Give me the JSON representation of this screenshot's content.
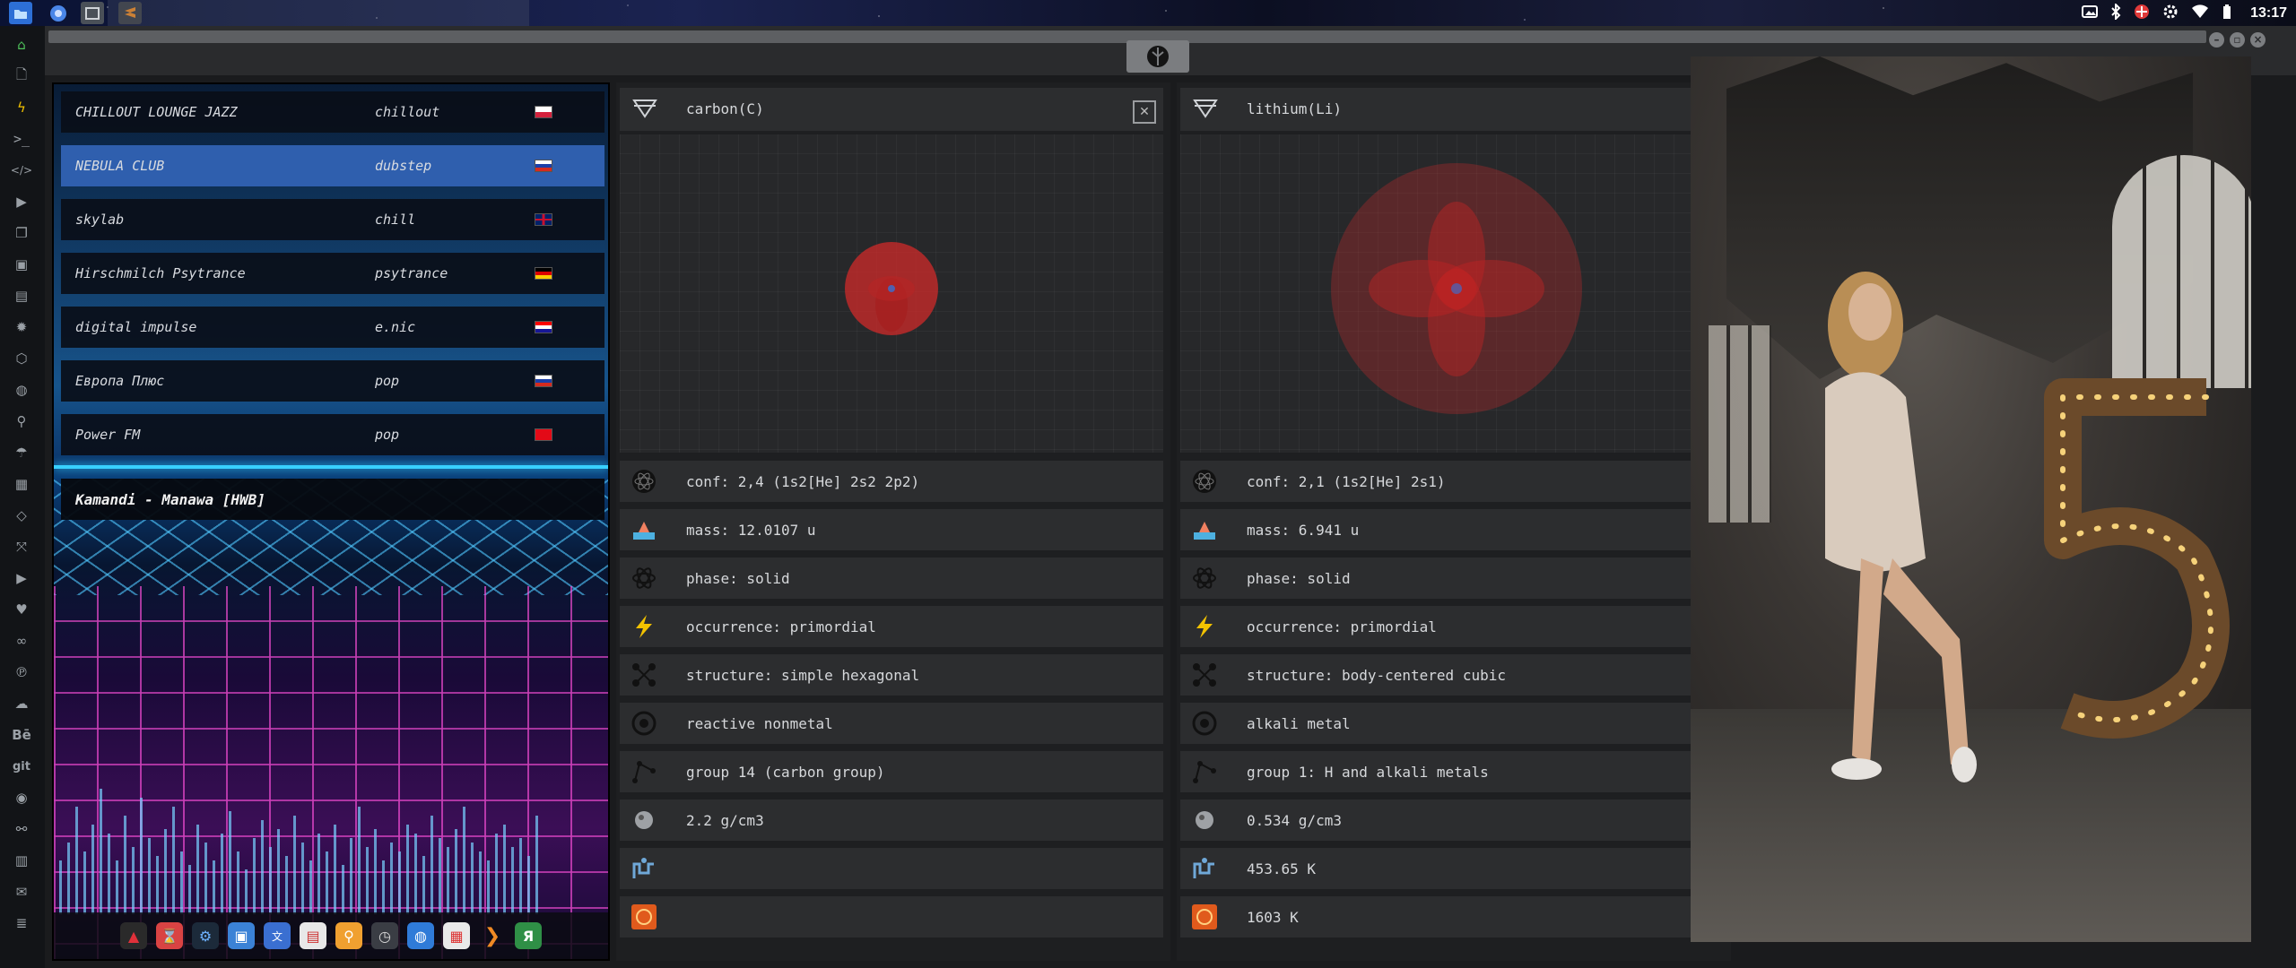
{
  "panel": {
    "clock": "13:17"
  },
  "window_title_emblem": "rebel-alliance-icon",
  "radio": {
    "stations": [
      {
        "name": "CHILLOUT LOUNGE JAZZ",
        "genre": "chillout",
        "flag": "poland"
      },
      {
        "name": "NEBULA CLUB",
        "genre": "dubstep",
        "flag": "russia",
        "selected": true
      },
      {
        "name": "skylab",
        "genre": "chill",
        "flag": "uk"
      },
      {
        "name": "Hirschmilch Psytrance",
        "genre": "psytrance",
        "flag": "germany"
      },
      {
        "name": "digital impulse",
        "genre": "e.nic",
        "flag": "croatia"
      },
      {
        "name": "Европа Плюс",
        "genre": "pop",
        "flag": "russia"
      },
      {
        "name": "Power FM",
        "genre": "pop",
        "flag": "turkey"
      }
    ],
    "now_playing": "Kamandi - Manawa [HWB]"
  },
  "carbon": {
    "title": "carbon(C)",
    "props": [
      {
        "icon": "atom-dark-icon",
        "text": "conf: 2,4 (1s2[He] 2s2 2p2)"
      },
      {
        "icon": "mass-scale-icon",
        "text": "mass: 12.0107 u"
      },
      {
        "icon": "atom-outline-icon",
        "text": "phase: solid"
      },
      {
        "icon": "lightning-icon",
        "text": "occurrence: primordial"
      },
      {
        "icon": "structure-icon",
        "text": "structure: simple hexagonal"
      },
      {
        "icon": "category-icon",
        "text": "reactive nonmetal"
      },
      {
        "icon": "group-icon",
        "text": "group 14 (carbon group)"
      },
      {
        "icon": "density-icon",
        "text": "2.2 g/cm3"
      },
      {
        "icon": "melting-icon",
        "text": ""
      },
      {
        "icon": "boiling-icon",
        "text": ""
      }
    ]
  },
  "lithium": {
    "title": "lithium(Li)",
    "props": [
      {
        "icon": "atom-dark-icon",
        "text": "conf: 2,1 (1s2[He] 2s1)"
      },
      {
        "icon": "mass-scale-icon",
        "text": "mass: 6.941 u"
      },
      {
        "icon": "atom-outline-icon",
        "text": "phase: solid"
      },
      {
        "icon": "lightning-icon",
        "text": "occurrence: primordial"
      },
      {
        "icon": "structure-icon",
        "text": "structure: body-centered cubic"
      },
      {
        "icon": "category-icon",
        "text": "alkali metal"
      },
      {
        "icon": "group-icon",
        "text": "group 1: H and alkali metals"
      },
      {
        "icon": "density-icon",
        "text": "0.534 g/cm3"
      },
      {
        "icon": "melting-icon",
        "text": "453.65 K"
      },
      {
        "icon": "boiling-icon",
        "text": "1603 K"
      }
    ]
  },
  "dock_left": {
    "behance": "Bē",
    "git": "git"
  },
  "colors": {
    "selected": "#2f5fae",
    "lightning": "#f2c200",
    "orbital": "#d02a2a",
    "accent_green": "#4ec25a"
  }
}
